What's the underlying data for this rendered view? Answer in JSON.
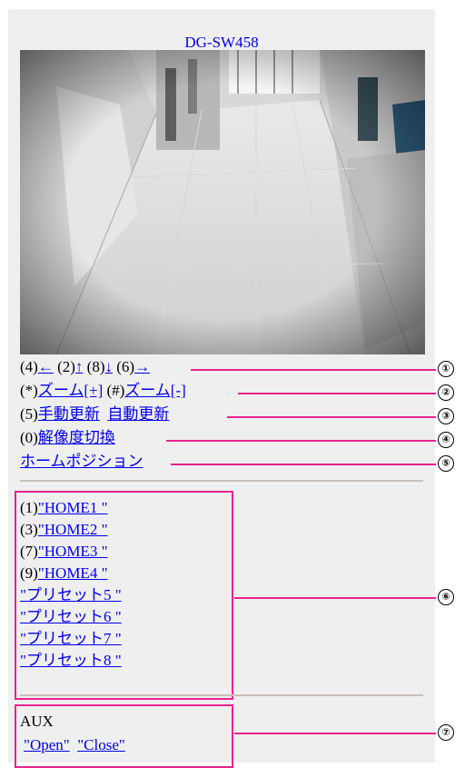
{
  "page": {
    "title": "DG-SW458"
  },
  "controls": {
    "pan_tilt": [
      {
        "prefix": "(4)",
        "label": "←"
      },
      {
        "prefix": "(2)",
        "label": "↑"
      },
      {
        "prefix": "(8)",
        "label": "↓"
      },
      {
        "prefix": "(6)",
        "label": "→"
      }
    ],
    "zoom_in": {
      "prefix": "(*)",
      "label": "ズーム[+]"
    },
    "zoom_out": {
      "prefix": "(#)",
      "label": "ズーム[-]"
    },
    "manual_refresh": {
      "prefix": "(5)",
      "label": "手動更新"
    },
    "auto_refresh": {
      "label": "自動更新"
    },
    "resolution": {
      "prefix": "(0)",
      "label": "解像度切換"
    },
    "home_position": {
      "label": "ホームポジション"
    }
  },
  "presets": [
    {
      "prefix": "(1)",
      "label": "\"HOME1 \""
    },
    {
      "prefix": "(3)",
      "label": "\"HOME2 \""
    },
    {
      "prefix": "(7)",
      "label": "\"HOME3 \""
    },
    {
      "prefix": "(9)",
      "label": "\"HOME4 \""
    },
    {
      "prefix": "",
      "label": "\"プリセット5 \""
    },
    {
      "prefix": "",
      "label": "\"プリセット6 \""
    },
    {
      "prefix": "",
      "label": "\"プリセット7 \""
    },
    {
      "prefix": "",
      "label": "\"プリセット8 \""
    }
  ],
  "aux": {
    "heading": "AUX",
    "open_label": "\"Open\"",
    "close_label": "\"Close\""
  },
  "callouts": [
    "①",
    "②",
    "③",
    "④",
    "⑤",
    "⑥",
    "⑦"
  ],
  "colors": {
    "link": "#0000ee",
    "callout": "#e8238e",
    "panel": "#efefef"
  }
}
